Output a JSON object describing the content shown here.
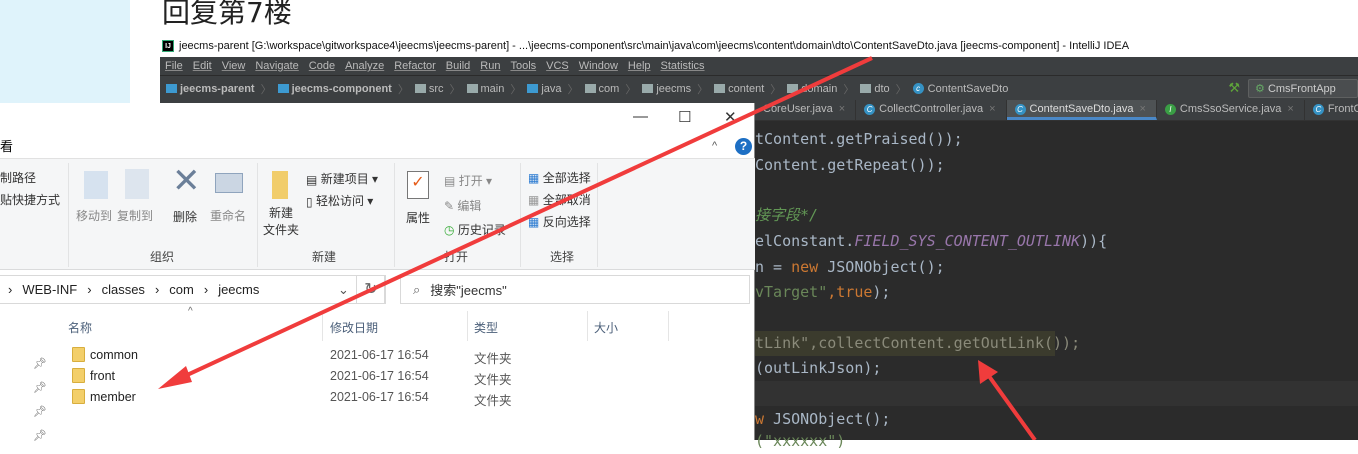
{
  "post": {
    "title": "回复第7楼"
  },
  "ide": {
    "window_title": "jeecms-parent [G:\\workspace\\gitworkspace4\\jeecms\\jeecms-parent] - ...\\jeecms-component\\src\\main\\java\\com\\jeecms\\content\\domain\\dto\\ContentSaveDto.java [jeecms-component] - IntelliJ IDEA",
    "logo": "IJ",
    "menu": [
      "File",
      "Edit",
      "View",
      "Navigate",
      "Code",
      "Analyze",
      "Refactor",
      "Build",
      "Run",
      "Tools",
      "VCS",
      "Window",
      "Help",
      "Statistics"
    ],
    "breadcrumb": [
      "jeecms-parent",
      "jeecms-component",
      "src",
      "main",
      "java",
      "com",
      "jeecms",
      "content",
      "domain",
      "dto",
      "ContentSaveDto"
    ],
    "run_config": "CmsFrontApp",
    "tabs": [
      {
        "label": "CoreUser.java",
        "icon": "C"
      },
      {
        "label": "CollectController.java",
        "icon": "C"
      },
      {
        "label": "ContentSaveDto.java",
        "icon": "C",
        "active": true
      },
      {
        "label": "CmsSsoService.java",
        "icon": "I"
      },
      {
        "label": "FrontContextI",
        "icon": "C"
      }
    ],
    "code": {
      "l1": "tContent.getPraised());",
      "l2": "Content.getRepeat());",
      "l3": "接字段*/",
      "l4a": "elConstant.",
      "l4b": "FIELD_SYS_CONTENT_OUTLINK",
      "l4c": ")){",
      "l5a": "n = ",
      "l5b": "new",
      "l5c": " JSONObject();",
      "l6a": "vTarget\"",
      "l6b": ",",
      "l6c": "true",
      "l6d": ");",
      "l7": "tLink\",collectContent.getOutLink());",
      "l8": "(outLinkJson);",
      "l9a": "w",
      "l9b": " JSONObject();",
      "l10": "(\"xxxxxx\")"
    }
  },
  "explorer": {
    "ribbon_tab": "看",
    "left_items": [
      "制路径",
      "贴快捷方式"
    ],
    "organize": {
      "move_to": "移动到",
      "copy_to": "复制到",
      "delete": "删除",
      "rename": "重命名",
      "label": "组织"
    },
    "new": {
      "new_folder": "新建\n文件夹",
      "new_item": "新建项目",
      "easy_access": "轻松访问",
      "label": "新建"
    },
    "open": {
      "properties": "属性",
      "open": "打开",
      "edit": "编辑",
      "history": "历史记录",
      "label": "打开"
    },
    "select": {
      "select_all": "全部选择",
      "select_none": "全部取消",
      "invert": "反向选择",
      "label": "选择"
    },
    "address": [
      "WEB-INF",
      "classes",
      "com",
      "jeecms"
    ],
    "search_placeholder": "搜索\"jeecms\"",
    "columns": [
      "名称",
      "修改日期",
      "类型",
      "大小"
    ],
    "rows": [
      {
        "name": "common",
        "date": "2021-06-17 16:54",
        "type": "文件夹"
      },
      {
        "name": "front",
        "date": "2021-06-17 16:54",
        "type": "文件夹"
      },
      {
        "name": "member",
        "date": "2021-06-17 16:54",
        "type": "文件夹"
      }
    ]
  }
}
